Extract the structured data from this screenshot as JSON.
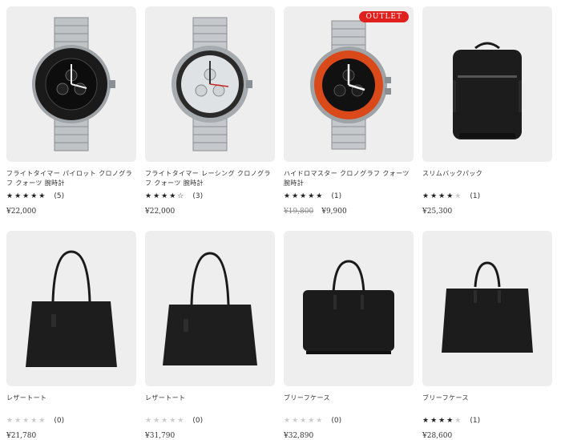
{
  "products": [
    {
      "name": "フライトタイマー パイロット クロノグラフ クォーツ 腕時計",
      "rating": 5,
      "review_count": "(5)",
      "price": "¥22,000",
      "image": "black-bezel-chronograph-watch"
    },
    {
      "name": "フライトタイマー レーシング クロノグラフ クォーツ 腕時計",
      "rating": 4.5,
      "review_count": "(3)",
      "price": "¥22,000",
      "image": "silver-dial-chronograph-watch"
    },
    {
      "name": "ハイドロマスター クロノグラフ クォーツ 腕時計",
      "rating": 5,
      "review_count": "(1)",
      "old_price": "¥19,800",
      "price": "¥9,900",
      "badge": "OUTLET",
      "image": "orange-bezel-diver-watch"
    },
    {
      "name": "スリムバックパック",
      "rating": 4,
      "review_count": "(1)",
      "price": "¥25,300",
      "image": "black-backpack"
    },
    {
      "name": "レザートート",
      "rating": 0,
      "review_count": "(0)",
      "price": "¥21,780",
      "image": "black-leather-tote"
    },
    {
      "name": "レザートート",
      "rating": 0,
      "review_count": "(0)",
      "price": "¥31,790",
      "image": "black-leather-tote-large"
    },
    {
      "name": "ブリーフケース",
      "rating": 0,
      "review_count": "(0)",
      "price": "¥32,890",
      "image": "black-briefcase"
    },
    {
      "name": "ブリーフケース",
      "rating": 4,
      "review_count": "(1)",
      "price": "¥28,600",
      "image": "black-briefcase-compact"
    }
  ],
  "colors": {
    "badge": "#e0201c",
    "star": "#222222",
    "star_empty": "#cccccc",
    "thumb_bg": "#eeeeee"
  }
}
